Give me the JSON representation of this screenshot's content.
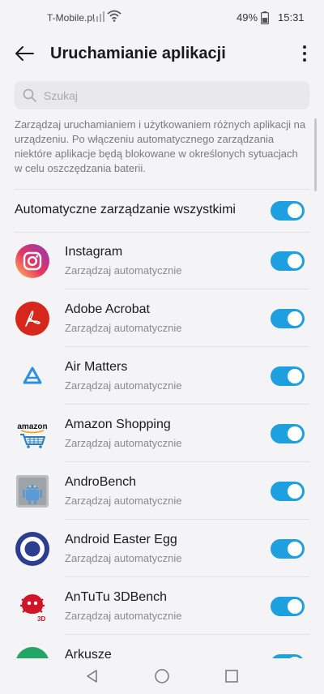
{
  "status_bar": {
    "carrier": "T-Mobile.pl",
    "battery": "49%",
    "time": "15:31"
  },
  "header": {
    "title": "Uruchamianie aplikacji"
  },
  "search": {
    "placeholder": "Szukaj"
  },
  "description": "Zarządzaj uruchamianiem i użytkowaniem różnych aplikacji na urządzeniu. Po włączeniu automatycznego zarządzania niektóre aplikacje będą blokowane w określonych sytuacjach w celu oszczędzania baterii.",
  "master": {
    "label": "Automatyczne zarządzanie wszystkimi",
    "enabled": true
  },
  "apps": [
    {
      "name": "Instagram",
      "status": "Zarządzaj automatycznie",
      "enabled": true,
      "icon": "instagram-icon"
    },
    {
      "name": "Adobe Acrobat",
      "status": "Zarządzaj automatycznie",
      "enabled": true,
      "icon": "adobe-acrobat-icon"
    },
    {
      "name": "Air Matters",
      "status": "Zarządzaj automatycznie",
      "enabled": true,
      "icon": "air-matters-icon"
    },
    {
      "name": "Amazon Shopping",
      "status": "Zarządzaj automatycznie",
      "enabled": true,
      "icon": "amazon-shopping-icon",
      "icon_text": "amazon"
    },
    {
      "name": "AndroBench",
      "status": "Zarządzaj automatycznie",
      "enabled": true,
      "icon": "androbench-icon"
    },
    {
      "name": "Android Easter Egg",
      "status": "Zarządzaj automatycznie",
      "enabled": true,
      "icon": "android-easter-egg-icon"
    },
    {
      "name": "AnTuTu 3DBench",
      "status": "Zarządzaj automatycznie",
      "enabled": true,
      "icon": "antutu-3dbench-icon",
      "icon_text": "3D"
    },
    {
      "name": "Arkusze",
      "status": "",
      "enabled": true,
      "icon": "arkusze-icon"
    }
  ],
  "colors": {
    "accent": "#1e9fe0",
    "background": "#f4f4f6"
  }
}
